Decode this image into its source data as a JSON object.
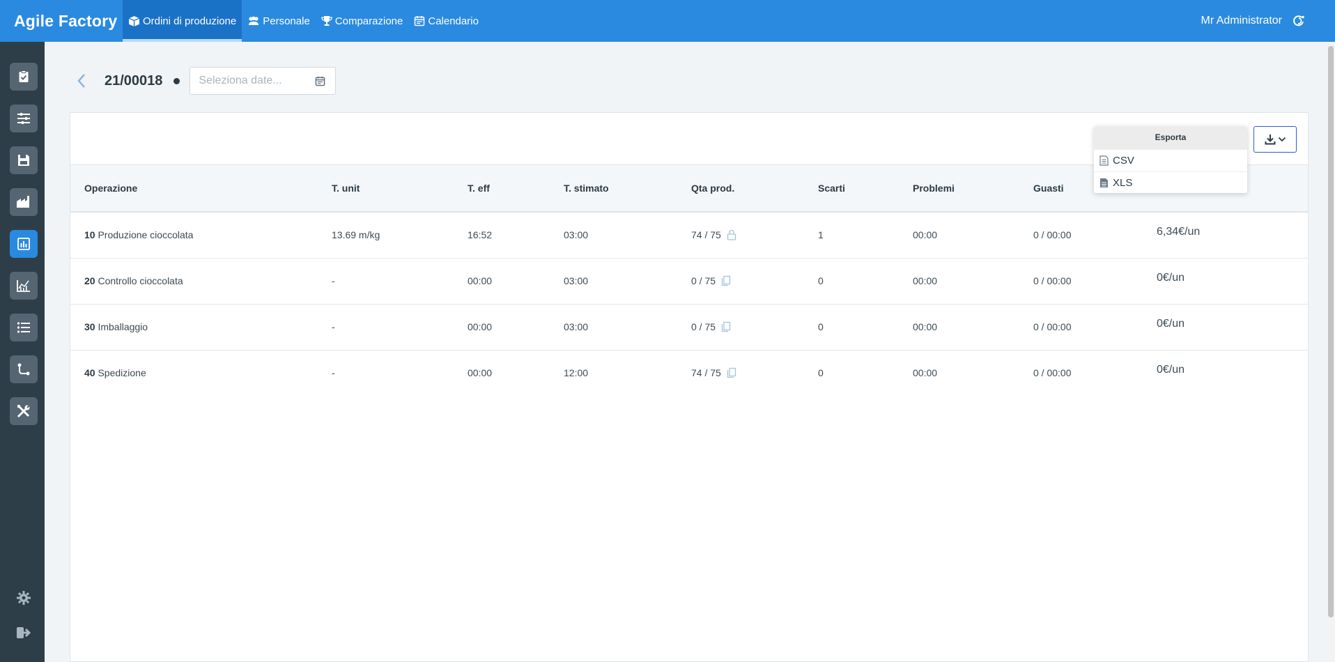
{
  "app": {
    "brand": "Agile Factory"
  },
  "topnav": [
    {
      "label": "Ordini di produzione",
      "icon": "box-icon",
      "active": true
    },
    {
      "label": "Personale",
      "icon": "users-icon"
    },
    {
      "label": "Comparazione",
      "icon": "trophy-icon"
    },
    {
      "label": "Calendario",
      "icon": "calendar-icon"
    }
  ],
  "user": {
    "name": "Mr Administrator",
    "icon": "logout-swirl-icon"
  },
  "sidebar": [
    {
      "icon": "clipboard-check-icon"
    },
    {
      "icon": "sliders-icon"
    },
    {
      "icon": "save-disk-icon"
    },
    {
      "icon": "factory-icon"
    },
    {
      "icon": "bar-chart-icon",
      "active": true
    },
    {
      "icon": "line-chart-icon"
    },
    {
      "icon": "list-icon"
    },
    {
      "icon": "flow-icon"
    },
    {
      "icon": "tools-icon"
    }
  ],
  "sidebar_bottom": [
    {
      "icon": "gear-icon"
    },
    {
      "icon": "sign-out-icon"
    }
  ],
  "header": {
    "order": "21/00018",
    "date_placeholder": "Seleziona date..."
  },
  "export": {
    "title": "Esporta",
    "items": [
      {
        "label": "CSV",
        "icon": "file-text-icon"
      },
      {
        "label": "XLS",
        "icon": "file-icon"
      }
    ]
  },
  "table": {
    "columns": [
      "Operazione",
      "T. unit",
      "T. eff",
      "T. stimato",
      "Qta prod.",
      "Scarti",
      "Problemi",
      "Guasti"
    ],
    "rows": [
      {
        "num": "10",
        "name": "Produzione cioccolata",
        "tunit": "13.69 m/kg",
        "teff": "16:52",
        "tstim": "03:00",
        "qta": "74 / 75",
        "qicon": "lock-icon",
        "scarti": "1",
        "problemi": "00:00",
        "guasti": "0 / 00:00",
        "cost": "6,34€/un"
      },
      {
        "num": "20",
        "name": "Controllo cioccolata",
        "tunit": "-",
        "teff": "00:00",
        "tstim": "03:00",
        "qta": "0 / 75",
        "qicon": "copy-icon",
        "scarti": "0",
        "problemi": "00:00",
        "guasti": "0 / 00:00",
        "cost": "0€/un"
      },
      {
        "num": "30",
        "name": "Imballaggio",
        "tunit": "-",
        "teff": "00:00",
        "tstim": "03:00",
        "qta": "0 / 75",
        "qicon": "copy-icon",
        "scarti": "0",
        "problemi": "00:00",
        "guasti": "0 / 00:00",
        "cost": "0€/un"
      },
      {
        "num": "40",
        "name": "Spedizione",
        "tunit": "-",
        "teff": "00:00",
        "tstim": "12:00",
        "qta": "74 / 75",
        "qicon": "copy-icon",
        "scarti": "0",
        "problemi": "00:00",
        "guasti": "0 / 00:00",
        "cost": "0€/un"
      }
    ]
  },
  "colors": {
    "primary": "#2a8ae0",
    "sidebar": "#2e3e48",
    "sidebar_btn": "#556572"
  }
}
